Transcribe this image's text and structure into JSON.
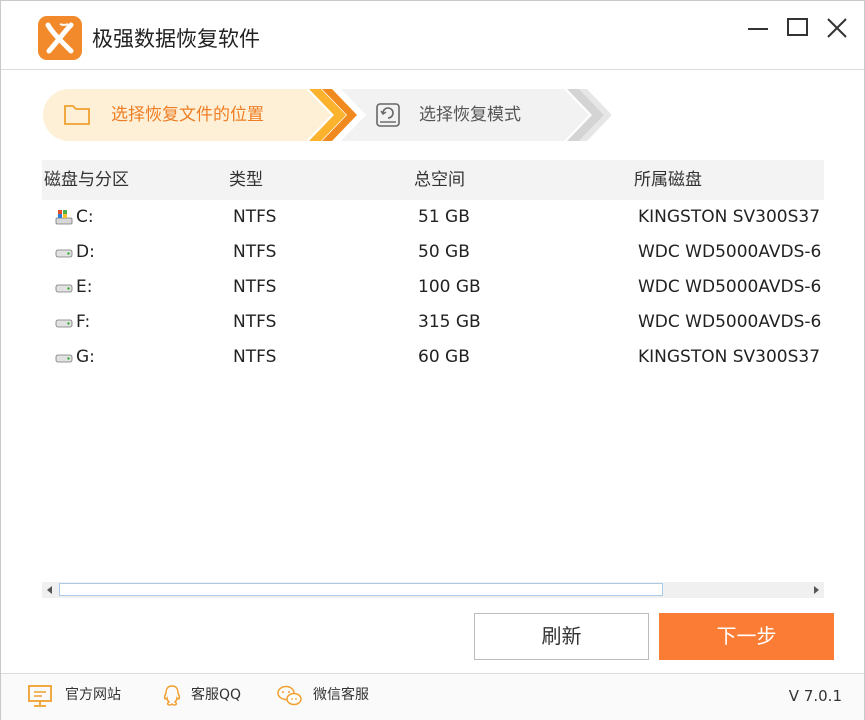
{
  "app": {
    "title": "极强数据恢复软件"
  },
  "steps": [
    {
      "label": "选择恢复文件的位置",
      "active": true
    },
    {
      "label": "选择恢复模式",
      "active": false
    }
  ],
  "colors": {
    "accent": "#f28a2c",
    "next_button": "#fb7c34",
    "active_step_bg": "#fdf0d6"
  },
  "table": {
    "headers": [
      "磁盘与分区",
      "类型",
      "总空间",
      "所属磁盘"
    ],
    "rows": [
      {
        "partition": "C:",
        "type": "NTFS",
        "size": "51 GB",
        "disk": "KINGSTON SV300S37",
        "icon": "system-drive-icon"
      },
      {
        "partition": "D:",
        "type": "NTFS",
        "size": "50 GB",
        "disk": "WDC WD5000AVDS-6",
        "icon": "hard-drive-icon"
      },
      {
        "partition": "E:",
        "type": "NTFS",
        "size": "100 GB",
        "disk": "WDC WD5000AVDS-6",
        "icon": "hard-drive-icon"
      },
      {
        "partition": "F:",
        "type": "NTFS",
        "size": "315 GB",
        "disk": "WDC WD5000AVDS-6",
        "icon": "hard-drive-icon"
      },
      {
        "partition": "G:",
        "type": "NTFS",
        "size": "60 GB",
        "disk": "KINGSTON SV300S37",
        "icon": "hard-drive-icon"
      }
    ]
  },
  "buttons": {
    "refresh": "刷新",
    "next": "下一步"
  },
  "footer": {
    "website": "官方网站",
    "qq_support": "客服QQ",
    "wechat_support": "微信客服",
    "version": "V 7.0.1"
  }
}
